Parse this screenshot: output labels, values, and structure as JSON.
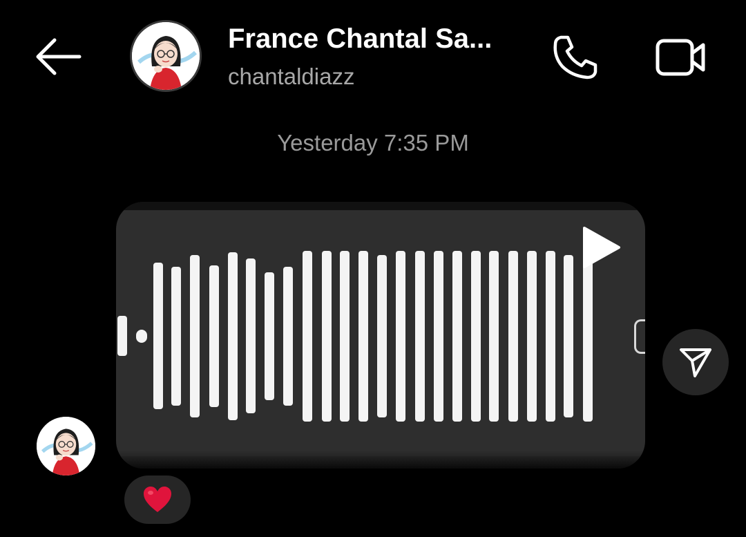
{
  "header": {
    "back_icon": "arrow-left-icon",
    "contact_name": "France Chantal Sa...",
    "contact_username": "chantaldiazz",
    "call_icon": "phone-icon",
    "video_icon": "video-camera-icon"
  },
  "thread": {
    "timestamp": "Yesterday 7:35 PM",
    "message": {
      "type": "voice-message",
      "play_icon": "play-icon",
      "waveform_levels": [
        0.15,
        0.05,
        0.55,
        0.52,
        0.61,
        0.53,
        0.63,
        0.58,
        0.48,
        0.52,
        0.64,
        0.64,
        0.64,
        0.64,
        0.61,
        0.64,
        0.64,
        0.64,
        0.64,
        0.64,
        0.64,
        0.64,
        0.64,
        0.64,
        0.61,
        0.64
      ]
    },
    "share_icon": "paper-plane-icon",
    "reaction": "❤️"
  },
  "colors": {
    "background": "#000000",
    "secondary_text": "#a8a8a8",
    "bubble": "#2e2e2e",
    "pill": "#262626",
    "heart": "#e0143c"
  }
}
